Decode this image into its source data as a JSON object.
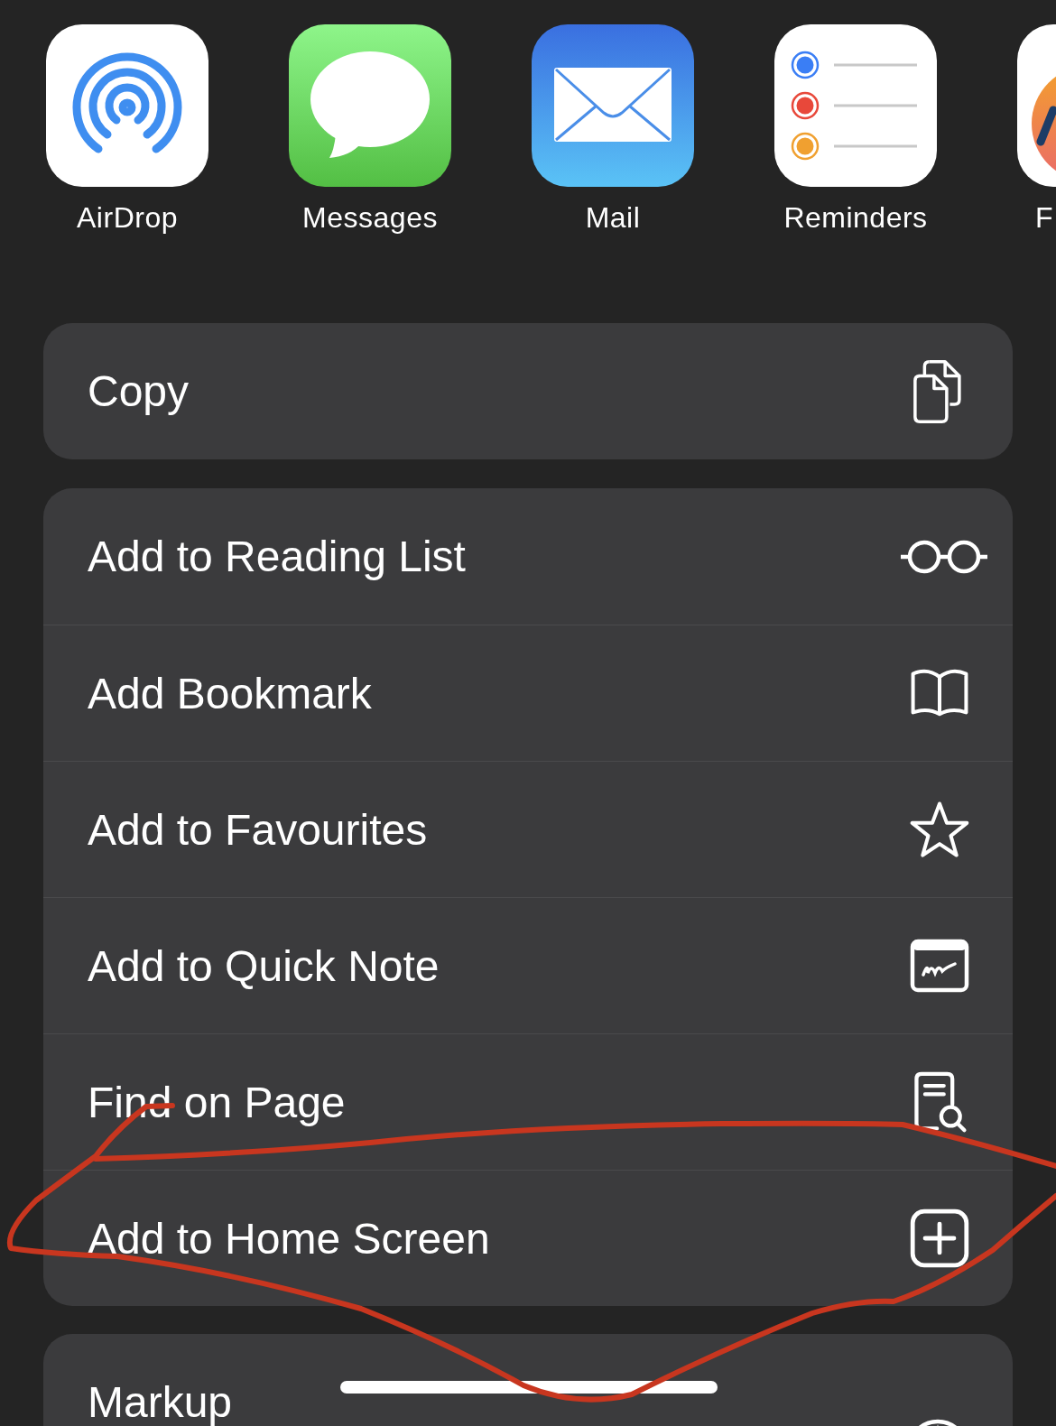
{
  "apps": [
    {
      "kind": "airdrop",
      "label": "AirDrop"
    },
    {
      "kind": "messages",
      "label": "Messages"
    },
    {
      "kind": "mail",
      "label": "Mail"
    },
    {
      "kind": "reminders",
      "label": "Reminders"
    },
    {
      "kind": "partial",
      "label": "F"
    }
  ],
  "action_groups": [
    [
      {
        "label": "Copy",
        "kind": "copy"
      }
    ],
    [
      {
        "label": "Add to Reading List",
        "kind": "glasses"
      },
      {
        "label": "Add Bookmark",
        "kind": "book"
      },
      {
        "label": "Add to Favourites",
        "kind": "star"
      },
      {
        "label": "Add to Quick Note",
        "kind": "note"
      },
      {
        "label": "Find on Page",
        "kind": "find"
      },
      {
        "label": "Add to Home Screen",
        "kind": "add"
      }
    ],
    [
      {
        "label": "Markup",
        "kind": "markup"
      }
    ]
  ]
}
